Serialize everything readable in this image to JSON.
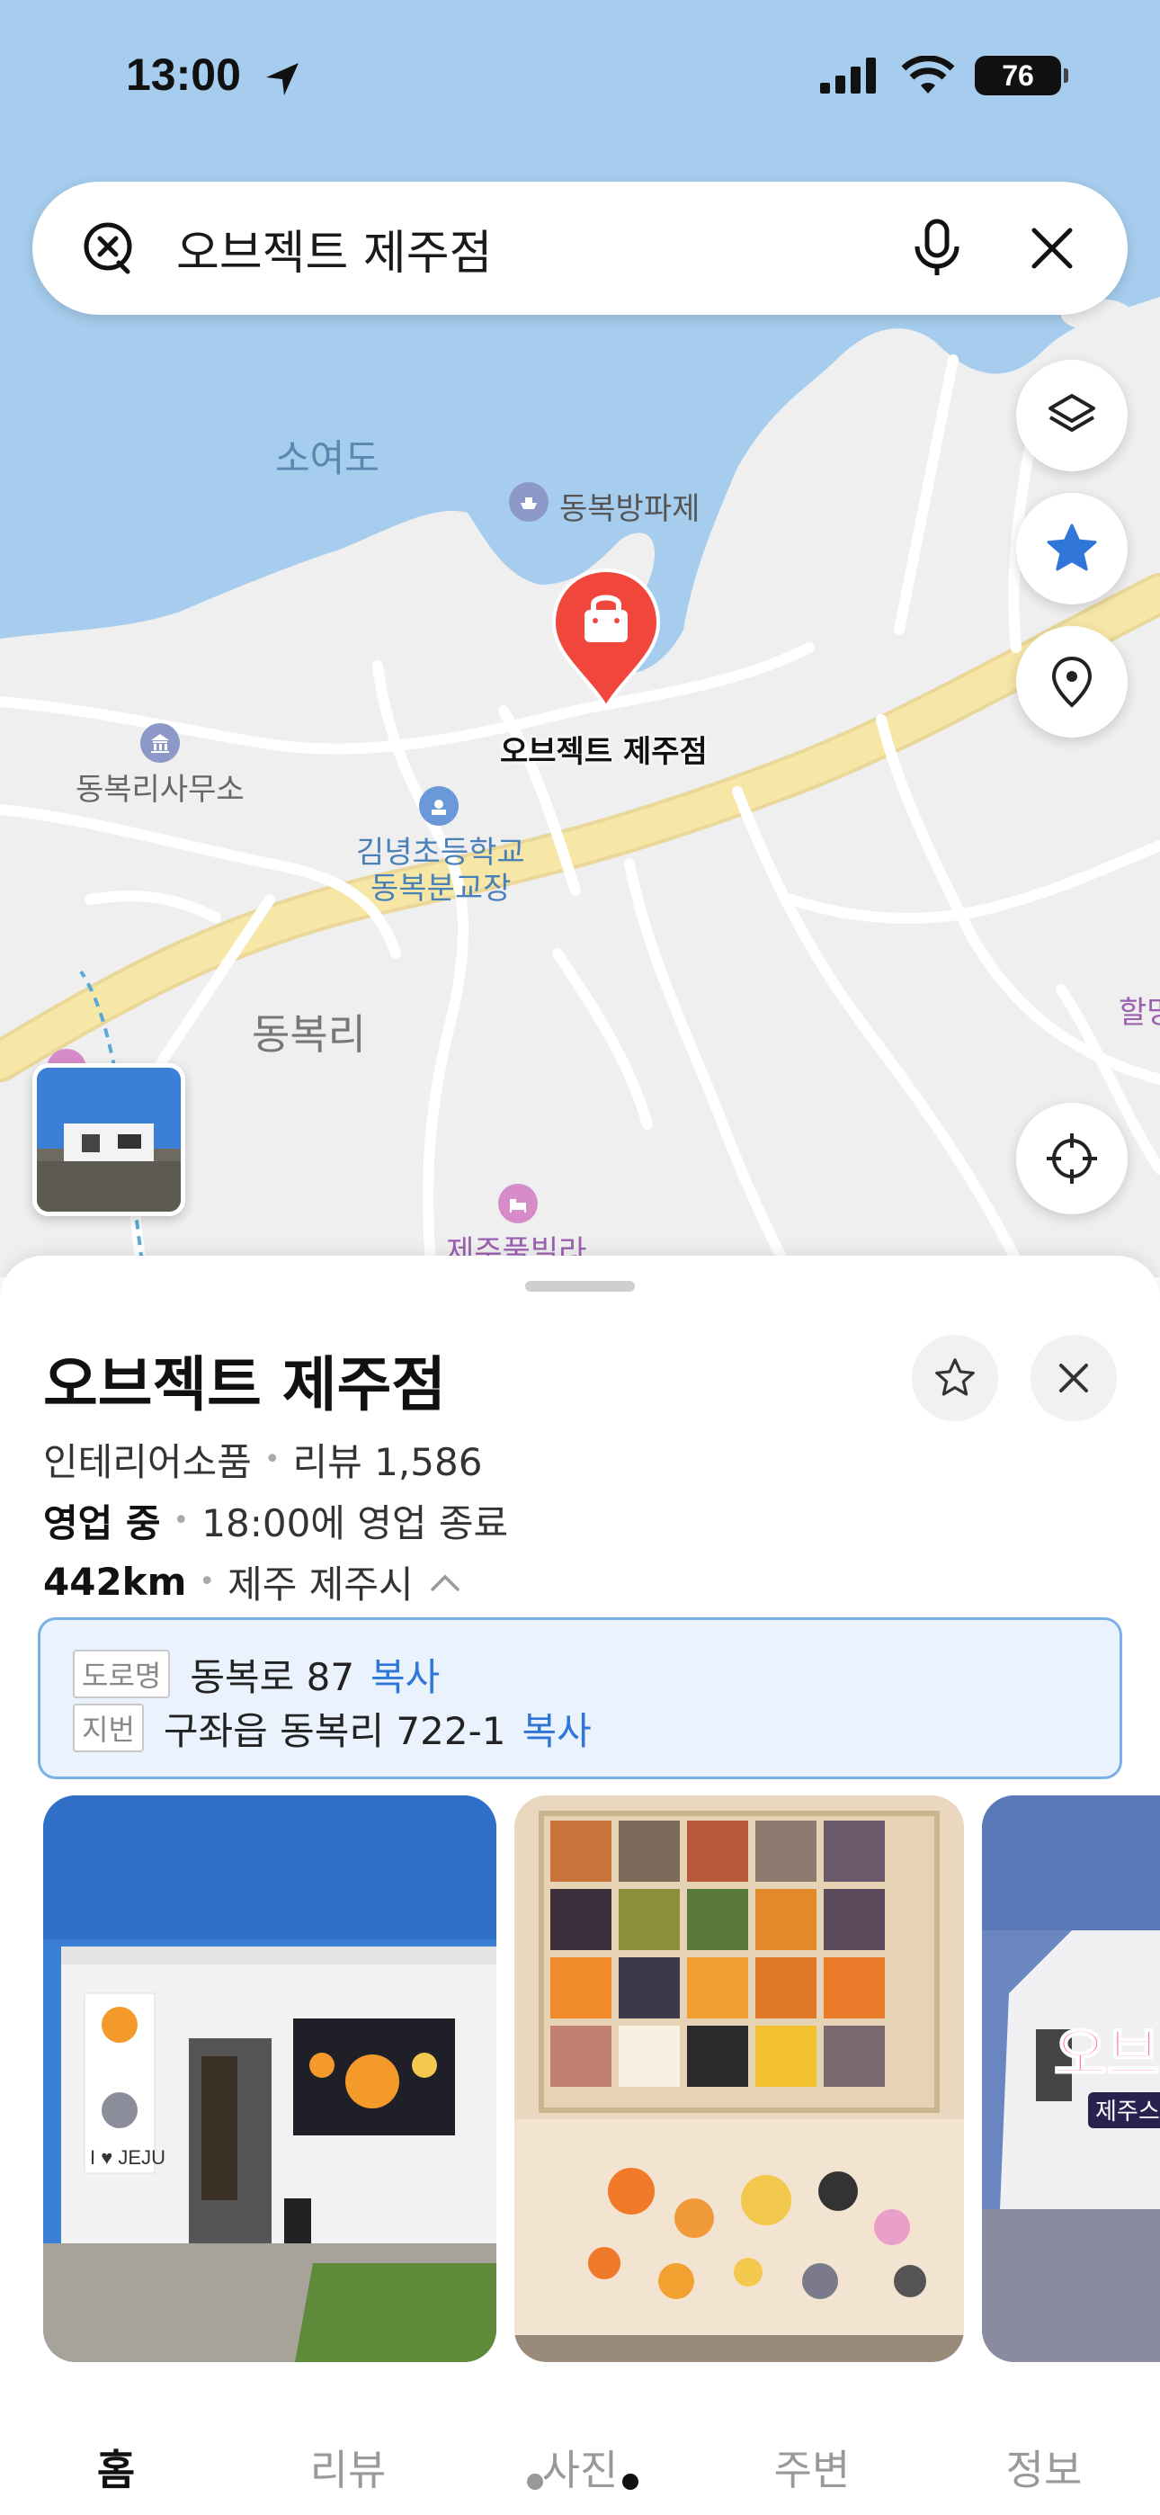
{
  "status_bar": {
    "time": "13:00",
    "battery": "76",
    "icons": [
      "location-arrow-icon",
      "signal-icon",
      "wifi-icon",
      "battery-icon"
    ]
  },
  "search": {
    "query": "오브젝트 제주점",
    "icons": [
      "clear-circle-icon",
      "microphone-icon",
      "close-icon"
    ]
  },
  "map": {
    "labels": {
      "island": "소여도",
      "breakwater": "동복방파제",
      "selected_place": "오브젝트 제주점",
      "office": "동복리사무소",
      "school_line1": "김녕초등학교",
      "school_line2": "동복분교장",
      "village": "동복리",
      "villa": "제주풀빌라",
      "edge_place": "할망"
    },
    "controls": [
      "layers-icon",
      "star-icon",
      "location-pin-icon",
      "crosshair-icon"
    ],
    "colors": {
      "sea": "#a6cdee",
      "land": "#efefef",
      "highway": "#f5e29a",
      "marker": "#f0463c",
      "favorite": "#2f76d8"
    }
  },
  "place": {
    "title": "오브젝트 제주점",
    "category": "인테리어소품",
    "reviews": "리뷰 1,586",
    "open_status": "영업 중",
    "hours": "18:00에 영업 종료",
    "distance": "442km",
    "region": "제주 제주시",
    "address": {
      "road_tag": "도로명",
      "road": "동복로 87",
      "lot_tag": "지번",
      "lot": "구좌읍 동복리 722-1",
      "copy_label": "복사"
    }
  },
  "photos": [
    {
      "name": "store-front-photo",
      "sign_text": "I ♥ JEJU"
    },
    {
      "name": "badge-display-photo"
    },
    {
      "name": "store-sign-photo",
      "sign_line1": "오브젝",
      "sign_line2": "제주스"
    }
  ],
  "tabs": [
    "홈",
    "리뷰",
    "사진",
    "주변",
    "정보"
  ]
}
